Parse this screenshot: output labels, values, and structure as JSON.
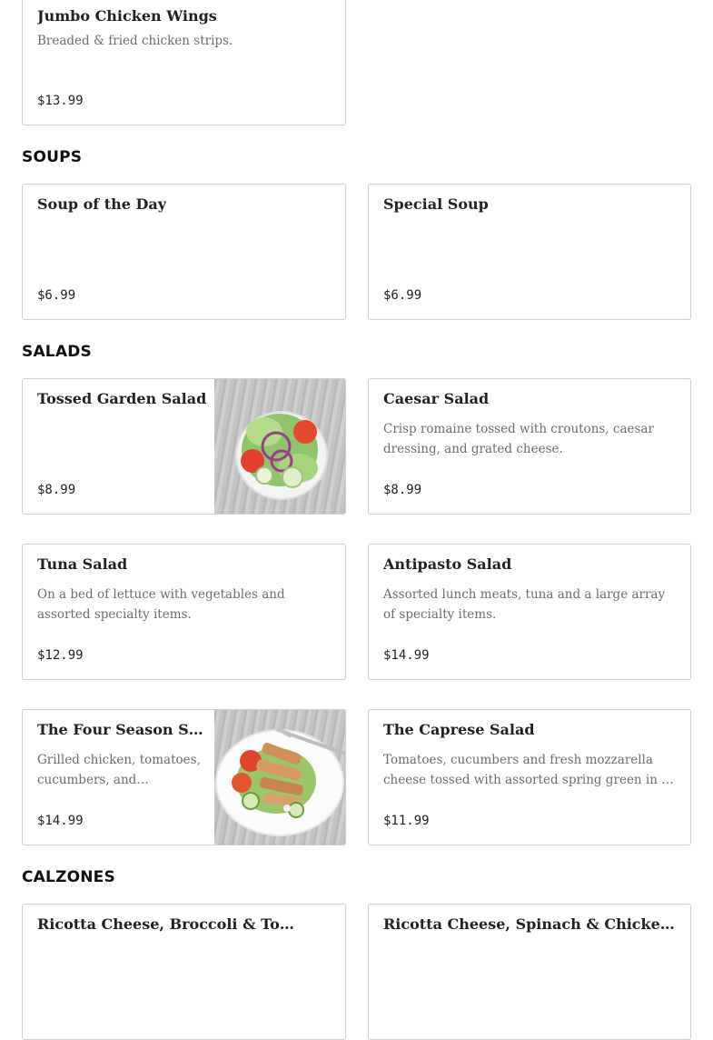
{
  "appetizers": {
    "items": [
      {
        "name": "Jumbo Chicken Wings",
        "description": "Breaded & fried chicken strips.",
        "price": "$13.99"
      }
    ]
  },
  "soups": {
    "title": "SOUPS",
    "items": [
      {
        "name": "Soup of the Day",
        "price": "$6.99"
      },
      {
        "name": "Special Soup",
        "price": "$6.99"
      }
    ]
  },
  "salads": {
    "title": "SALADS",
    "items": [
      {
        "name": "Tossed Garden Salad",
        "price": "$8.99",
        "image": "salad-photo"
      },
      {
        "name": "Caesar Salad",
        "description": "Crisp romaine tossed with croutons, caesar dressing, and grated cheese.",
        "price": "$8.99"
      },
      {
        "name": "Tuna Salad",
        "description": "On a bed of lettuce with vegetables and assorted specialty items.",
        "price": "$12.99"
      },
      {
        "name": "Antipasto Salad",
        "description": "Assorted lunch meats, tuna and a large array of specialty items.",
        "price": "$14.99"
      },
      {
        "name": "The Four Season Salad",
        "description": "Grilled chicken, tomatoes, cucumbers, and gorgonzola cheese over mixed greens.",
        "price": "$14.99",
        "image": "grilled-chicken-salad-photo"
      },
      {
        "name": "The Caprese Salad",
        "description": "Tomatoes, cucumbers and fresh mozzarella cheese tossed with assorted spring green in a balsamic vinaigrette.",
        "price": "$11.99"
      }
    ]
  },
  "calzones": {
    "title": "CALZONES",
    "items": [
      {
        "name": "Ricotta Cheese, Broccoli & Tomatoes Calzone"
      },
      {
        "name": "Ricotta Cheese, Spinach & Chicken Calzone"
      }
    ]
  }
}
